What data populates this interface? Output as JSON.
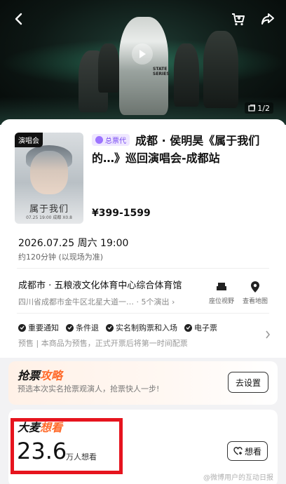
{
  "hero": {
    "image_counter": "1/2",
    "hero_text": "STATE SERIES"
  },
  "event": {
    "category_tag": "演唱会",
    "agent_badge": "总票代",
    "title": "成都 · 侯明昊《属于我们的…》巡回演唱会-成都站",
    "price_range": "¥399-1599",
    "poster_title": "属于我们",
    "poster_info": "07.25 19:00   成都   X0.8"
  },
  "schedule": {
    "datetime": "2026.07.25 周六 19:00",
    "duration": "约120分钟 (以现场为准)"
  },
  "venue": {
    "name": "成都市 · 五粮液文化体育中心综合体育馆",
    "address": "四川省成都市金牛区北星大道一…",
    "shows": "5个演出",
    "seat_view_label": "座位视野",
    "map_label": "查看地图"
  },
  "notices": {
    "items": [
      "重要通知",
      "条件退",
      "实名制购票和入场",
      "电子票"
    ],
    "presale_text": "预售 | 本商品为预售，正式开票后将第一时间配票"
  },
  "strategy": {
    "title_prefix": "抢票",
    "title_accent": "攻略",
    "desc": "预选本次实名抢票观演人，抢票快人一步!",
    "button": "去设置"
  },
  "want": {
    "title_prefix": "大麦",
    "title_accent": "想看",
    "count": "23.6",
    "unit": "万人想看",
    "button": "想看"
  },
  "watermark": "@微博用户的互动日报"
}
